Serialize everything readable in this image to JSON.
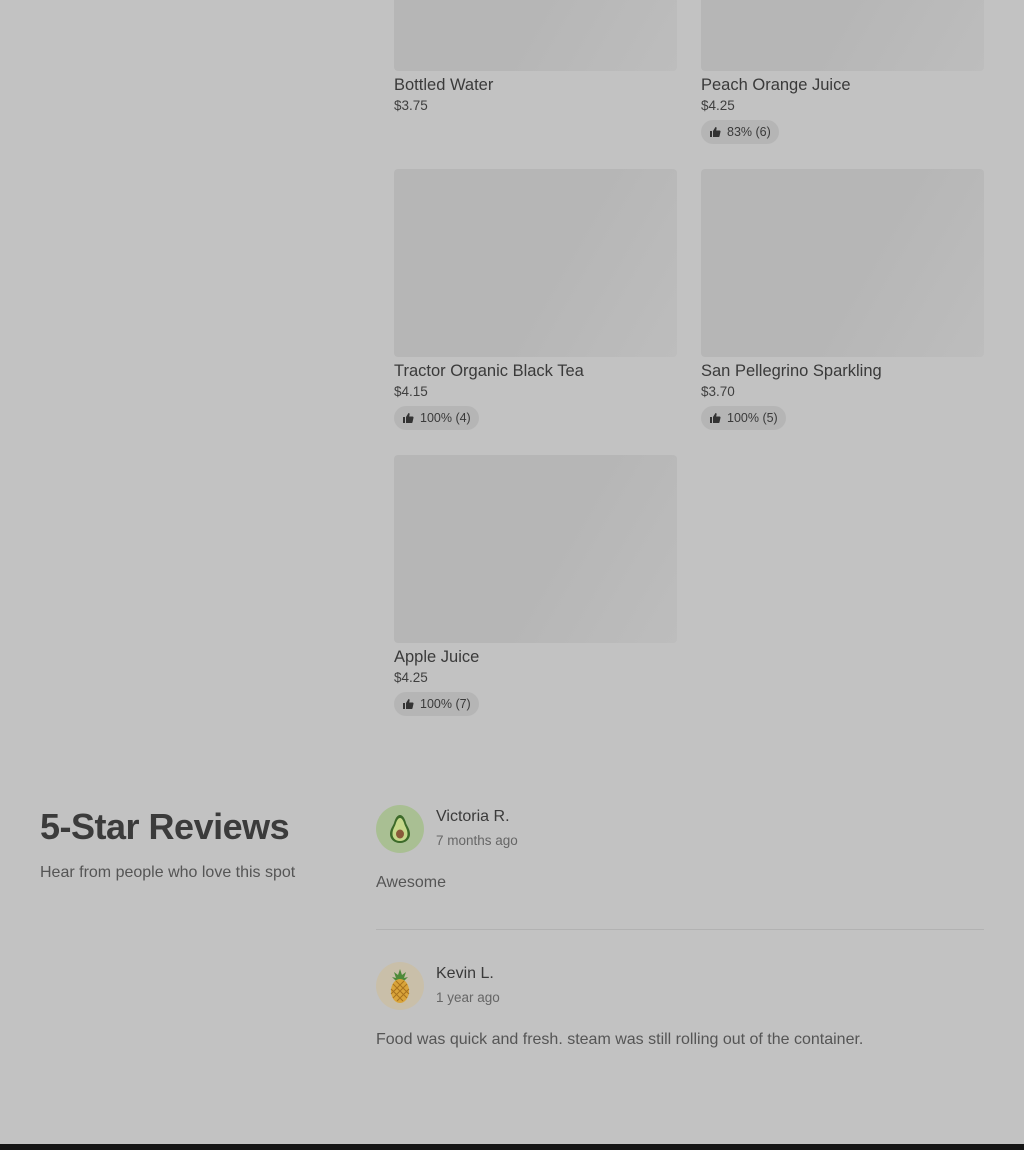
{
  "menu": {
    "items": [
      {
        "name": "Bottled Water",
        "price": "$3.75",
        "rating": ""
      },
      {
        "name": "Peach Orange Juice",
        "price": "$4.25",
        "rating": "83% (6)"
      },
      {
        "name": "Tractor Organic Black Tea",
        "price": "$4.15",
        "rating": "100% (4)"
      },
      {
        "name": "San Pellegrino Sparkling",
        "price": "$3.70",
        "rating": "100% (5)"
      },
      {
        "name": "Apple Juice",
        "price": "$4.25",
        "rating": "100% (7)"
      }
    ],
    "rating_icon": "thumbs-up-icon"
  },
  "reviews": {
    "title": "5-Star Reviews",
    "subtitle": "Hear from people who love this spot",
    "items": [
      {
        "name": "Victoria R.",
        "time": "7 months ago",
        "text": "Awesome",
        "avatar_icon": "avocado-icon",
        "avatar_bg": "#a9bf93"
      },
      {
        "name": "Kevin L.",
        "time": "1 year ago",
        "text": "Food was quick and fresh. steam was still rolling out of the container.",
        "avatar_icon": "pineapple-icon",
        "avatar_bg": "#c9bfa9"
      }
    ]
  },
  "colors": {
    "page_background": "#c2c2c2",
    "footer": "#141414"
  }
}
